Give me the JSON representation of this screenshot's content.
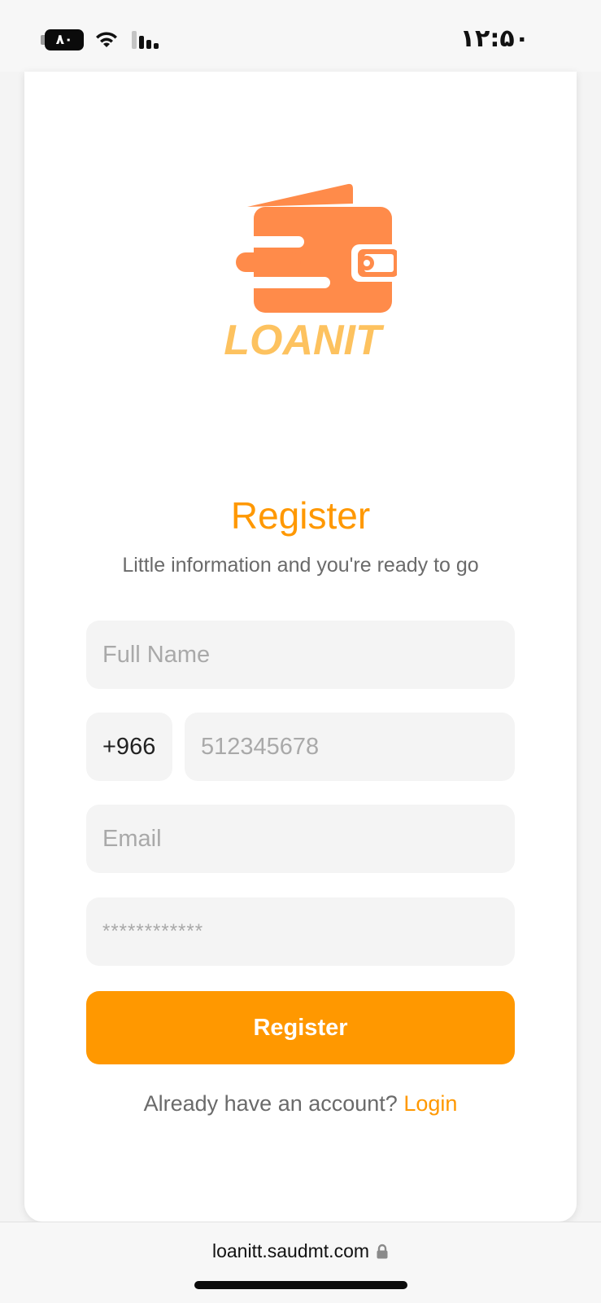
{
  "status_bar": {
    "battery_level": "۸۰",
    "time": "۱۲:۵۰"
  },
  "logo": {
    "text": "LOANIT",
    "wallet_color": "#ff8b4a",
    "text_color": "#fdc25f"
  },
  "form": {
    "title": "Register",
    "subtitle": "Little information and you're ready to go",
    "full_name_placeholder": "Full Name",
    "country_code": "+966",
    "phone_placeholder": "512345678",
    "email_placeholder": "Email",
    "password_placeholder": "************",
    "register_button": "Register",
    "already_text": "Already have an account?",
    "login_link": "Login"
  },
  "browser": {
    "url": "loanitt.saudmt.com"
  },
  "colors": {
    "accent": "#ff9800",
    "field_bg": "#f4f4f4"
  }
}
